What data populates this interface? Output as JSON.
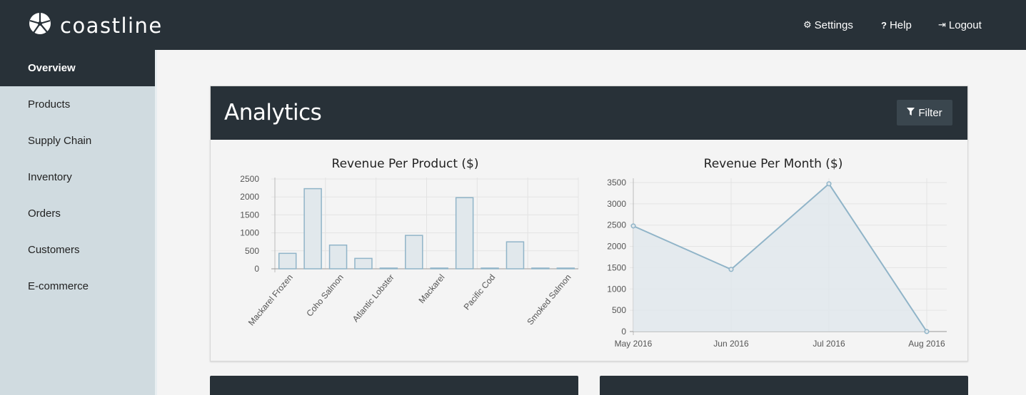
{
  "app": {
    "name": "coastline"
  },
  "topnav": {
    "settings": {
      "label": "Settings",
      "icon": "gear-icon"
    },
    "help": {
      "label": "Help",
      "icon": "question-icon"
    },
    "logout": {
      "label": "Logout",
      "icon": "logout-icon"
    }
  },
  "sidebar": {
    "items": [
      {
        "label": "Overview",
        "active": true
      },
      {
        "label": "Products"
      },
      {
        "label": "Supply Chain"
      },
      {
        "label": "Inventory"
      },
      {
        "label": "Orders"
      },
      {
        "label": "Customers"
      },
      {
        "label": "E-commerce"
      }
    ]
  },
  "analytics": {
    "title": "Analytics",
    "filter_label": "Filter"
  },
  "colors": {
    "topbar": "#283138",
    "sidebar": "#d0dbe0",
    "accent_line": "#90b4c8",
    "accent_fill": "#e1e8ec"
  },
  "chart_data": [
    {
      "type": "bar",
      "title": "Revenue Per Product ($)",
      "categories": [
        "Mackarel Frozen",
        "",
        "Coho Salmon",
        "",
        "Atlantic Lobster",
        "",
        "Mackarel",
        "",
        "Pacific Cod",
        "",
        "",
        "Smoked Salmon"
      ],
      "values": [
        430,
        2230,
        660,
        290,
        0,
        930,
        0,
        1980,
        0,
        750,
        0,
        0
      ],
      "ylim": [
        0,
        2500
      ],
      "yticks": [
        0,
        500,
        1000,
        1500,
        2000,
        2500
      ],
      "grid": true
    },
    {
      "type": "area",
      "title": "Revenue Per Month ($)",
      "x": [
        "May 2016",
        "Jun 2016",
        "Jul 2016",
        "Aug 2016"
      ],
      "values": [
        2480,
        1460,
        3470,
        0
      ],
      "ylim": [
        0,
        3500
      ],
      "yticks": [
        0,
        500,
        1000,
        1500,
        2000,
        2500,
        3000,
        3500
      ],
      "grid": true
    }
  ]
}
